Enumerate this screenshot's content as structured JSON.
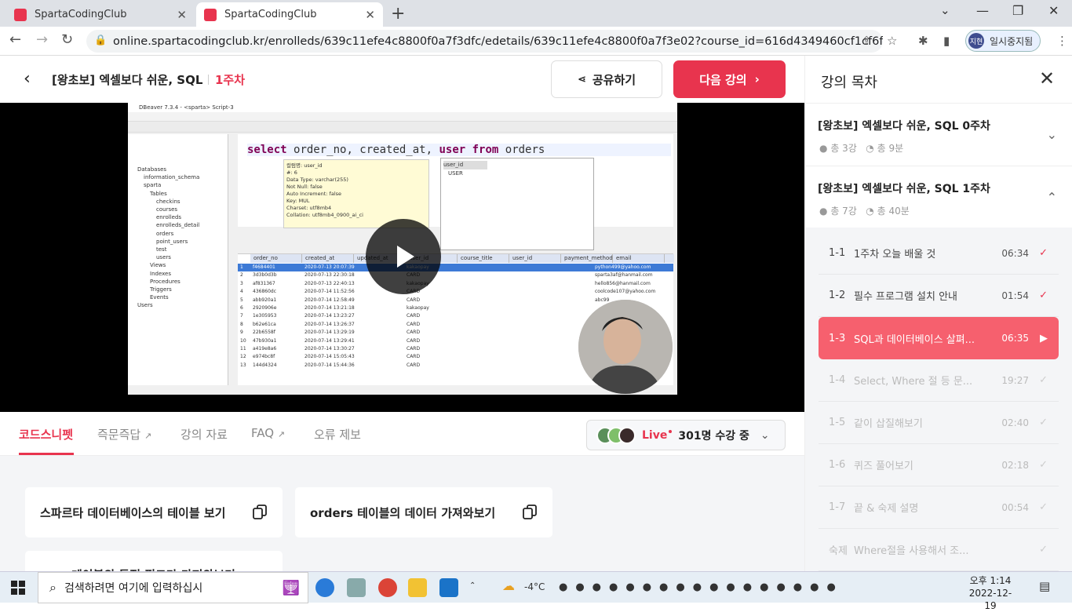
{
  "browser": {
    "tabs": [
      {
        "title": "SpartaCodingClub"
      },
      {
        "title": "SpartaCodingClub"
      }
    ],
    "url": "online.spartacodingclub.kr/enrolleds/639c11efe4c8800f0a7f3dfc/edetails/639c11efe4c8800f0a7f3e02?course_id=616d4349460cf1cf6f9579ec",
    "profile_initials": "지현",
    "profile_label": "일시중지됨"
  },
  "header": {
    "course_title": "[왕초보] 엑셀보다 쉬운, SQL",
    "week": "1주차",
    "share_label": "공유하기",
    "next_label": "다음 강의"
  },
  "video": {
    "ide_title": "DBeaver 7.3.4 - <sparta> Script-3",
    "sql_keyword1": "select",
    "sql_cols": "order_no, created_at,",
    "sql_keyword2": "user from",
    "sql_table": "orders",
    "tooltip": [
      "컬럼명: user_id",
      "#: 6",
      "Data Type: varchar(255)",
      "Not Null: false",
      "Auto Increment: false",
      "Key: MUL",
      "Charset: utf8mb4",
      "Collation: utf8mb4_0900_ai_ci"
    ],
    "autocomplete": [
      "user_id",
      "USER"
    ],
    "tree": [
      "Databases",
      "information_schema",
      "sparta",
      "Tables",
      "checkins",
      "courses",
      "enrolleds",
      "enrolleds_detail",
      "orders",
      "point_users",
      "test",
      "users",
      "Views",
      "Indexes",
      "Procedures",
      "Triggers",
      "Events",
      "Users"
    ],
    "table_headers": [
      "order_no",
      "created_at",
      "updated_at",
      "user_id",
      "course_title",
      "user_id",
      "payment_method",
      "email"
    ],
    "rows": [
      [
        "1",
        "f4684401",
        "2020-07-13 20:07:39",
        "kakaopay",
        "python499@yahoo.com"
      ],
      [
        "2",
        "3d3b0d3b",
        "2020-07-13 22:30:18",
        "CARD",
        "sparta3af@hanmail.com"
      ],
      [
        "3",
        "af831367",
        "2020-07-13 22:40:13",
        "kakaopay",
        "hello856@hanmail.com"
      ],
      [
        "4",
        "436860dc",
        "2020-07-14 11:52:56",
        "CARD",
        "coolcode107@yahoo.com"
      ],
      [
        "5",
        "abb920a1",
        "2020-07-14 12:58:49",
        "CARD",
        "abc99"
      ],
      [
        "6",
        "2920906e",
        "2020-07-14 13:21:18",
        "kakaopay",
        ""
      ],
      [
        "7",
        "1e305953",
        "2020-07-14 13:23:27",
        "CARD",
        ""
      ],
      [
        "8",
        "b62e61ca",
        "2020-07-14 13:26:37",
        "CARD",
        ""
      ],
      [
        "9",
        "22b6558f",
        "2020-07-14 13:29:19",
        "CARD",
        ""
      ],
      [
        "10",
        "47b930a1",
        "2020-07-14 13:29:41",
        "CARD",
        ""
      ],
      [
        "11",
        "a419e8a6",
        "2020-07-14 13:30:27",
        "CARD",
        ""
      ],
      [
        "12",
        "e974bc8f",
        "2020-07-14 15:05:43",
        "CARD",
        ""
      ],
      [
        "13",
        "144d4324",
        "2020-07-14 15:44:36",
        "CARD",
        ""
      ]
    ]
  },
  "subtabs": {
    "items": [
      "코드스니펫",
      "즉문즉답",
      "강의 자료",
      "FAQ",
      "오류 제보"
    ],
    "live_label": "Live",
    "viewers": "301명 수강 중"
  },
  "snippets": [
    "스파르타 데이터베이스의 테이블 보기",
    "orders 테이블의 데이터 가져와보기",
    "테이블의 특정 필드만 가져와보기"
  ],
  "sidebar": {
    "title": "강의 목차",
    "weeks": [
      {
        "title": "[왕초보] 엑셀보다 쉬운, SQL 0주차",
        "lessons": "총 3강",
        "time": "총 9분"
      },
      {
        "title": "[왕초보] 엑셀보다 쉬운, SQL 1주차",
        "lessons": "총 7강",
        "time": "총 40분"
      }
    ],
    "lessons": [
      {
        "num": "1-1",
        "title": "1주차 오늘 배울 것",
        "time": "06:34"
      },
      {
        "num": "1-2",
        "title": "필수 프로그램 설치 안내",
        "time": "01:54"
      },
      {
        "num": "1-3",
        "title": "SQL과 데이터베이스 살펴...",
        "time": "06:35"
      },
      {
        "num": "1-4",
        "title": "Select, Where 절 등 문...",
        "time": "19:27"
      },
      {
        "num": "1-5",
        "title": "같이 삽질해보기",
        "time": "02:40"
      },
      {
        "num": "1-6",
        "title": "퀴즈 풀어보기",
        "time": "02:18"
      },
      {
        "num": "1-7",
        "title": "끝 & 숙제 설명",
        "time": "00:54"
      },
      {
        "num": "숙제",
        "title": "Where절을 사용해서 조...",
        "time": ""
      }
    ]
  },
  "taskbar": {
    "search_placeholder": "검색하려면 여기에 입력하십시",
    "weather": "-4°C",
    "time": "오후 1:14",
    "date": "2022-12-19"
  },
  "colors": {
    "accent": "#e8344e",
    "current_lesson": "#f6606e"
  }
}
